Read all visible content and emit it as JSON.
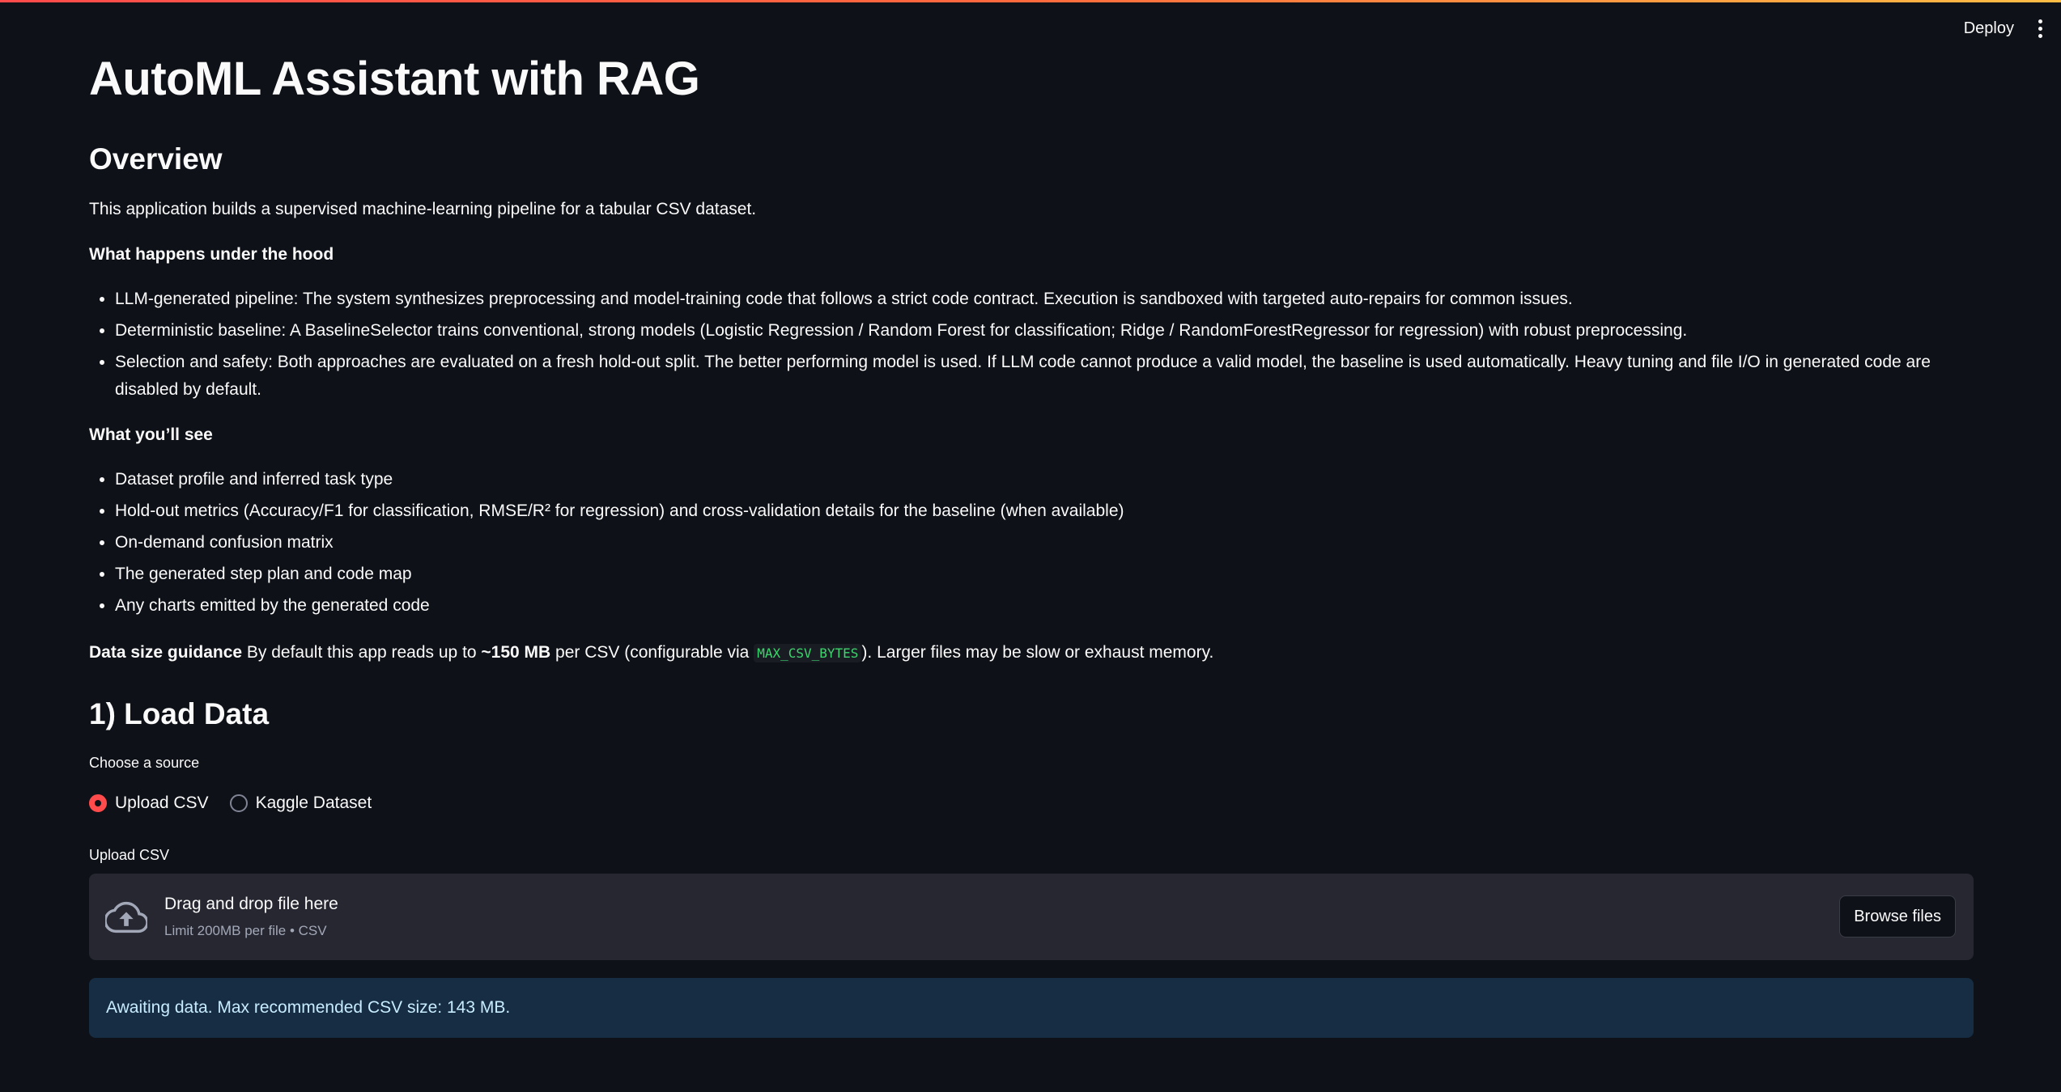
{
  "header": {
    "deploy_label": "Deploy",
    "menu_icon": "kebab-menu-icon"
  },
  "colors": {
    "background": "#0e1117",
    "accent": "#ff4b4b",
    "code_text": "#3dd56d",
    "info_background": "#172d43",
    "info_text": "#c7ebff"
  },
  "page": {
    "title": "AutoML Assistant with RAG"
  },
  "overview": {
    "heading": "Overview",
    "intro": "This application builds a supervised machine-learning pipeline for a tabular CSV dataset.",
    "under_hood_heading": "What happens under the hood",
    "under_hood_items": [
      "LLM-generated pipeline: The system synthesizes preprocessing and model-training code that follows a strict code contract. Execution is sandboxed with targeted auto-repairs for common issues.",
      "Deterministic baseline: A BaselineSelector trains conventional, strong models (Logistic Regression / Random Forest for classification; Ridge / RandomForestRegressor for regression) with robust preprocessing.",
      "Selection and safety: Both approaches are evaluated on a fresh hold-out split. The better performing model is used. If LLM code cannot produce a valid model, the baseline is used automatically. Heavy tuning and file I/O in generated code are disabled by default."
    ],
    "see_heading": "What you’ll see",
    "see_items": [
      "Dataset profile and inferred task type",
      "Hold-out metrics (Accuracy/F1 for classification, RMSE/R² for regression) and cross-validation details for the baseline (when available)",
      "On-demand confusion matrix",
      "The generated step plan and code map",
      "Any charts emitted by the generated code"
    ],
    "guidance": {
      "label": "Data size guidance",
      "text_a": " By default this app reads up to ",
      "size": "~150 MB",
      "text_b": " per CSV (configurable via ",
      "code": "MAX_CSV_BYTES",
      "text_c": "). Larger files may be slow or exhaust memory."
    }
  },
  "load_data": {
    "heading": "1) Load Data",
    "source_label": "Choose a source",
    "options": [
      {
        "label": "Upload CSV",
        "selected": true
      },
      {
        "label": "Kaggle Dataset",
        "selected": false
      }
    ],
    "upload_label": "Upload CSV",
    "dropzone": {
      "icon": "cloud-upload-icon",
      "title": "Drag and drop file here",
      "subtitle": "Limit 200MB per file • CSV",
      "button": "Browse files"
    },
    "info_message": "Awaiting data. Max recommended CSV size: 143 MB."
  }
}
